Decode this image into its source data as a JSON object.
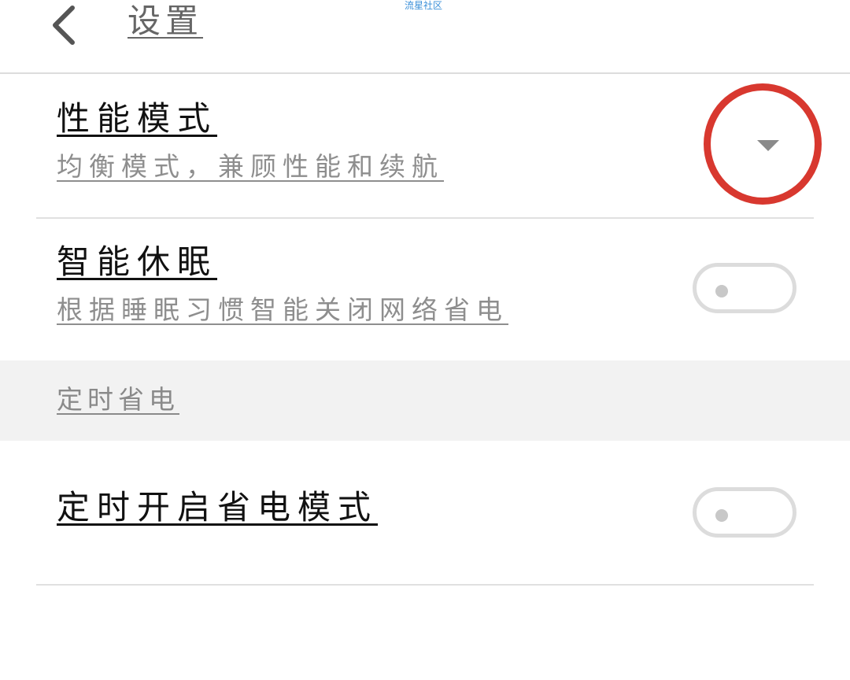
{
  "header": {
    "back_icon": "chevron-left-icon",
    "title": "设置",
    "watermark": "流星社区"
  },
  "rows": [
    {
      "title": "性能模式",
      "subtitle": "均衡模式，兼顾性能和续航",
      "control": "dropdown",
      "icon": "caret-down-icon"
    },
    {
      "title": "智能休眠",
      "subtitle": "根据睡眠习惯智能关闭网络省电",
      "control": "toggle",
      "checked": false
    }
  ],
  "section": {
    "title": "定时省电"
  },
  "section_rows": [
    {
      "title": "定时开启省电模式",
      "control": "toggle",
      "checked": false
    }
  ],
  "colors": {
    "highlight": "#d8382f",
    "toggle_border": "#dcdcdc",
    "section_bg": "#f2f2f2"
  }
}
